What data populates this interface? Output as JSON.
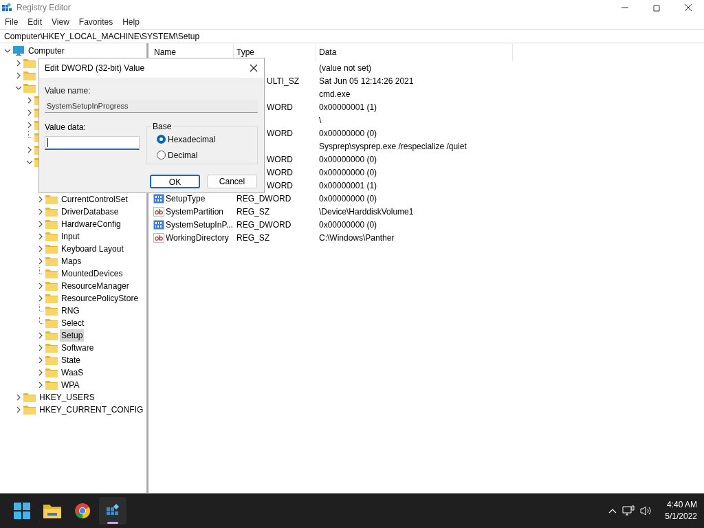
{
  "window": {
    "title": "Registry Editor"
  },
  "menu": [
    "File",
    "Edit",
    "View",
    "Favorites",
    "Help"
  ],
  "address": "Computer\\HKEY_LOCAL_MACHINE\\SYSTEM\\Setup",
  "tree": [
    {
      "label": "Computer",
      "kind": "computer",
      "expanded": true,
      "selected": false,
      "children": [
        {
          "expanded": false
        },
        {
          "expanded": false
        },
        {
          "expanded": true,
          "children": [
            {
              "expanded": false
            },
            {
              "expanded": false
            },
            {
              "expanded": false
            },
            {
              "kind": "leaf"
            },
            {
              "expanded": false
            },
            {
              "expanded": true,
              "children": [
                {
                  "label": "CurrentControlSet",
                  "expanded": false,
                  "selected": false
                },
                {
                  "label": "DriverDatabase",
                  "expanded": false,
                  "selected": false
                },
                {
                  "label": "HardwareConfig",
                  "expanded": false,
                  "selected": false
                },
                {
                  "label": "Input",
                  "expanded": false,
                  "selected": false
                },
                {
                  "label": "Keyboard Layout",
                  "expanded": false,
                  "selected": false
                },
                {
                  "label": "Maps",
                  "expanded": false,
                  "selected": false
                },
                {
                  "label": "MountedDevices",
                  "kind": "leaf",
                  "selected": false
                },
                {
                  "label": "ResourceManager",
                  "expanded": false,
                  "selected": false
                },
                {
                  "label": "ResourcePolicyStore",
                  "expanded": false,
                  "selected": false
                },
                {
                  "label": "RNG",
                  "kind": "leaf",
                  "selected": false
                },
                {
                  "label": "Select",
                  "kind": "leaf",
                  "selected": false
                },
                {
                  "label": "Setup",
                  "expanded": false,
                  "selected": true
                },
                {
                  "label": "Software",
                  "expanded": false,
                  "selected": false
                },
                {
                  "label": "State",
                  "expanded": false,
                  "selected": false
                },
                {
                  "label": "WaaS",
                  "expanded": false,
                  "selected": false
                },
                {
                  "label": "WPA",
                  "expanded": false,
                  "selected": false
                }
              ]
            }
          ]
        },
        {
          "label": "HKEY_USERS",
          "expanded": false,
          "selected": false
        },
        {
          "label": "HKEY_CURRENT_CONFIG",
          "expanded": false,
          "selected": false
        }
      ]
    }
  ],
  "columns": [
    "Name",
    "Type",
    "Data"
  ],
  "values": [
    {
      "data": "(value not set)"
    },
    {
      "type": "ULTI_SZ",
      "data": "Sat Jun 05 12:14:26 2021"
    },
    {
      "data": "cmd.exe"
    },
    {
      "type": "WORD",
      "data": "0x00000001 (1)"
    },
    {
      "data": "\\"
    },
    {
      "type": "WORD",
      "data": "0x00000000 (0)"
    },
    {
      "data": "Sysprep\\sysprep.exe /respecialize /quiet"
    },
    {
      "type": "WORD",
      "data": "0x00000000 (0)"
    },
    {
      "type": "WORD",
      "data": "0x00000000 (0)"
    },
    {
      "type": "WORD",
      "data": "0x00000001 (1)"
    },
    {
      "kind": "dword",
      "name": "SetupType",
      "type": "REG_DWORD",
      "data": "0x00000000 (0)"
    },
    {
      "kind": "string",
      "name": "SystemPartition",
      "type": "REG_SZ",
      "data": "\\Device\\HarddiskVolume1"
    },
    {
      "kind": "dword",
      "name": "SystemSetupInP...",
      "type": "REG_DWORD",
      "data": "0x00000000 (0)"
    },
    {
      "kind": "string",
      "name": "WorkingDirectory",
      "type": "REG_SZ",
      "data": "C:\\Windows\\Panther"
    }
  ],
  "dialog": {
    "title": "Edit DWORD (32-bit) Value",
    "name_label": "Value name:",
    "name_value": "SystemSetupInProgress",
    "data_label": "Value data:",
    "base_label": "Base",
    "bases": [
      {
        "label": "Hexadecimal",
        "selected": true
      },
      {
        "label": "Decimal",
        "selected": false
      }
    ],
    "buttons": [
      {
        "label": "OK",
        "default": true
      },
      {
        "label": "Cancel",
        "default": false
      }
    ]
  },
  "taskbar": {
    "apps": [
      {
        "kind": "start",
        "active": false
      },
      {
        "kind": "folder",
        "active": false
      },
      {
        "kind": "browser",
        "active": false
      },
      {
        "kind": "registry",
        "active": true
      }
    ],
    "time": "4:40 AM",
    "date": "5/1/2022"
  }
}
